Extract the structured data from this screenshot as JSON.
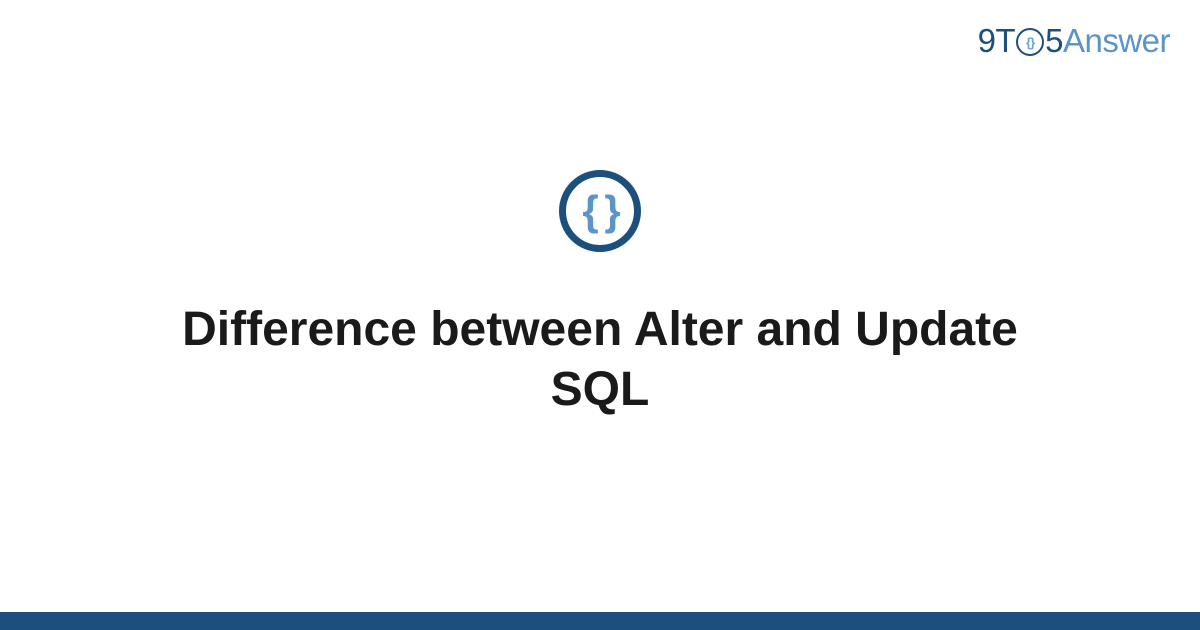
{
  "logo": {
    "prefix": "9T",
    "o_inner": "{}",
    "five": "5",
    "suffix": "Answer"
  },
  "icon": {
    "braces": "{ }"
  },
  "title": "Difference between Alter and Update SQL",
  "colors": {
    "primary": "#1c4f7c",
    "accent": "#5a94c9"
  }
}
